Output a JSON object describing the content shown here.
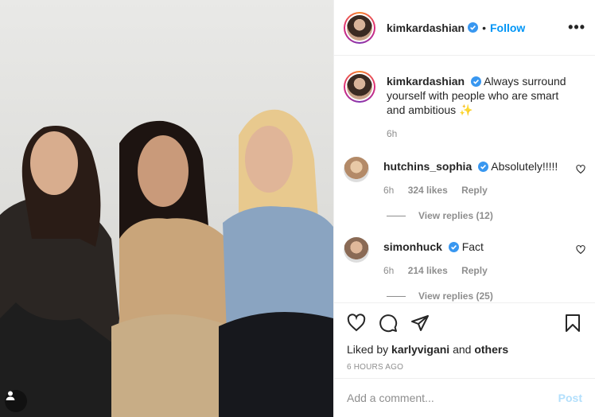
{
  "post": {
    "author": "kimkardashian",
    "follow_label": "Follow",
    "more_label": "•••",
    "separator": "•"
  },
  "caption": {
    "username": "kimkardashian",
    "text": "Always surround yourself with people who are smart and ambitious",
    "emoji": "✨",
    "time": "6h"
  },
  "comments": [
    {
      "username": "hutchins_sophia",
      "text": "Absolutely!!!!!",
      "time": "6h",
      "likes": "324 likes",
      "reply": "Reply",
      "view_replies": "View replies (12)"
    },
    {
      "username": "simonhuck",
      "text": "Fact",
      "time": "6h",
      "likes": "214 likes",
      "reply": "Reply",
      "view_replies": "View replies (25)"
    }
  ],
  "likes": {
    "prefix": "Liked by",
    "user": "karlyvigani",
    "middle": "and",
    "others": "others"
  },
  "timestamp": "6 HOURS AGO",
  "composer": {
    "placeholder": "Add a comment...",
    "post_label": "Post"
  },
  "colors": {
    "follow": "#0095f6",
    "verified": "#3897f0",
    "post_disabled": "#b2dffc",
    "muted": "#8e8e8e"
  }
}
